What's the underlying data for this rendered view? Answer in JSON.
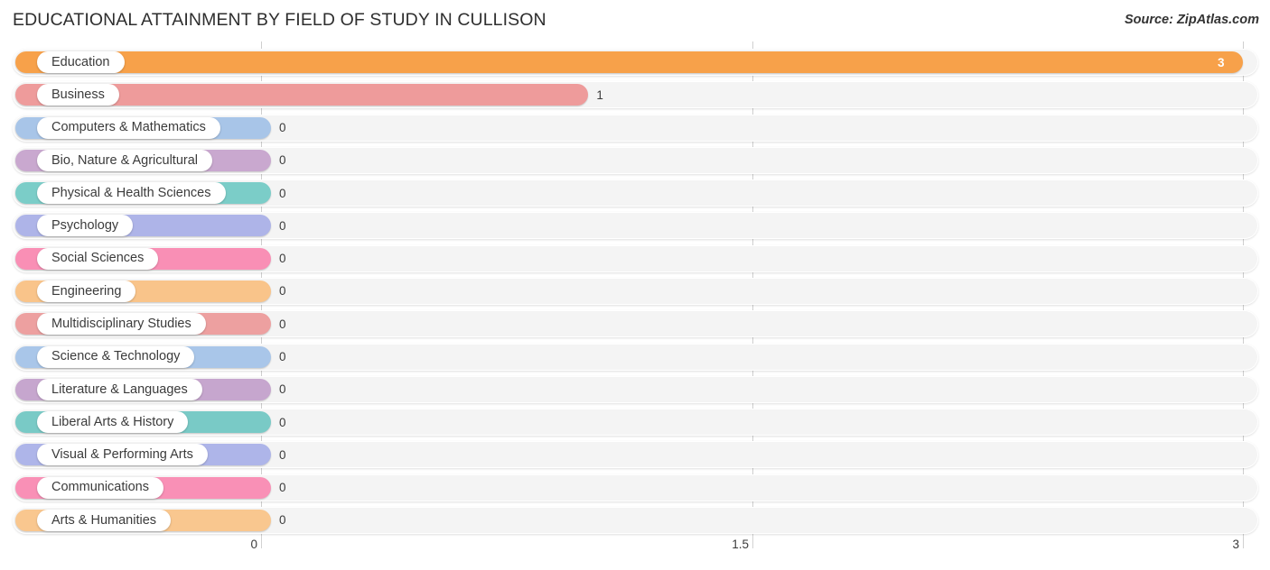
{
  "header": {
    "title": "EDUCATIONAL ATTAINMENT BY FIELD OF STUDY IN CULLISON",
    "source": "Source: ZipAtlas.com"
  },
  "chart_data": {
    "type": "bar",
    "orientation": "horizontal",
    "title": "EDUCATIONAL ATTAINMENT BY FIELD OF STUDY IN CULLISON",
    "subtitle": "",
    "xlabel": "",
    "ylabel": "",
    "xlim": [
      0,
      3
    ],
    "ticks": [
      "0",
      "1.5",
      "3"
    ],
    "tick_values": [
      0,
      1.5,
      3
    ],
    "grid": true,
    "legend": "none",
    "categories": [
      "Education",
      "Business",
      "Computers & Mathematics",
      "Bio, Nature & Agricultural",
      "Physical & Health Sciences",
      "Psychology",
      "Social Sciences",
      "Engineering",
      "Multidisciplinary Studies",
      "Science & Technology",
      "Literature & Languages",
      "Liberal Arts & History",
      "Visual & Performing Arts",
      "Communications",
      "Arts & Humanities"
    ],
    "values": [
      3,
      1,
      0,
      0,
      0,
      0,
      0,
      0,
      0,
      0,
      0,
      0,
      0,
      0,
      0
    ],
    "value_labels": [
      "3",
      "1",
      "0",
      "0",
      "0",
      "0",
      "0",
      "0",
      "0",
      "0",
      "0",
      "0",
      "0",
      "0",
      "0"
    ],
    "colors": [
      "#f5a css-placeholder",
      "#ea9999"
    ],
    "bar_colors": [
      "#f8a košice"
    ]
  },
  "bars": [
    {
      "label": "Education",
      "value": 3,
      "value_label": "3",
      "color": "#f8a council"
    },
    {
      "label": "Business",
      "value": 1,
      "value_label": "1",
      "color": "#ee9e9e"
    }
  ],
  "palette": {
    "orange": "#f7a14a",
    "salmon": "#ee9b9b",
    "blue": "#a8c5e8",
    "purple": "#c9a8cf",
    "teal": "#7bcdc8",
    "periwinkle": "#aeb4e8",
    "pink": "#f98fb5",
    "peach": "#f9c48a",
    "rose": "#eda0a0",
    "steel": "#a9c6e9",
    "lilac": "#c6a6ce",
    "aqua": "#79cac6",
    "lavender": "#aeb5e9",
    "hotpink": "#f990b6",
    "apricot": "#f9c78f"
  },
  "rows": [
    {
      "label": "Education",
      "value_label": "3",
      "value": 3,
      "color": "#f7a14a",
      "inside": true
    },
    {
      "label": "Business",
      "value_label": "1",
      "value": 1,
      "color": "#ee9b9b",
      "inside": false
    },
    {
      "label": "Computers & Mathematics",
      "value_label": "0",
      "value": 0,
      "color": "#a8c5e8",
      "inside": false
    },
    {
      "label": "Bio, Nature & Agricultural",
      "value_label": "0",
      "value": 0,
      "color": "#c9a8cf",
      "inside": false
    },
    {
      "label": "Physical & Health Sciences",
      "value_label": "0",
      "value": 0,
      "color": "#7bcdc8",
      "inside": false
    },
    {
      "label": "Psychology",
      "value_label": "0",
      "value": 0,
      "color": "#aeb4e8",
      "inside": false
    },
    {
      "label": "Social Sciences",
      "value_label": "0",
      "value": 0,
      "color": "#f98fb5",
      "inside": false
    },
    {
      "label": "Engineering",
      "value_label": "0",
      "value": 0,
      "color": "#f9c48a",
      "inside": false
    },
    {
      "label": "Multidisciplinary Studies",
      "value_label": "0",
      "value": 0,
      "color": "#eda0a0",
      "inside": false
    },
    {
      "label": "Science & Technology",
      "value_label": "0",
      "value": 0,
      "color": "#a9c6e9",
      "inside": false
    },
    {
      "label": "Literature & Languages",
      "value_label": "0",
      "value": 0,
      "color": "#c6a6ce",
      "inside": false
    },
    {
      "label": "Liberal Arts & History",
      "value_label": "0",
      "value": 0,
      "color": "#79cac6",
      "inside": false
    },
    {
      "label": "Visual & Performing Arts",
      "value_label": "0",
      "value": 0,
      "color": "#aeb5e9",
      "inside": false
    },
    {
      "label": "Communications",
      "value_label": "0",
      "value": 0,
      "color": "#f990b6",
      "inside": false
    },
    {
      "label": "Arts & Humanities",
      "value_label": "0",
      "value": 0,
      "color": "#f9c78f",
      "inside": false
    }
  ],
  "axis": {
    "ticks": [
      {
        "label": "0",
        "value": 0
      },
      {
        "label": "1.5",
        "value": 1.5
      },
      {
        "label": "3",
        "value": 3
      }
    ]
  }
}
